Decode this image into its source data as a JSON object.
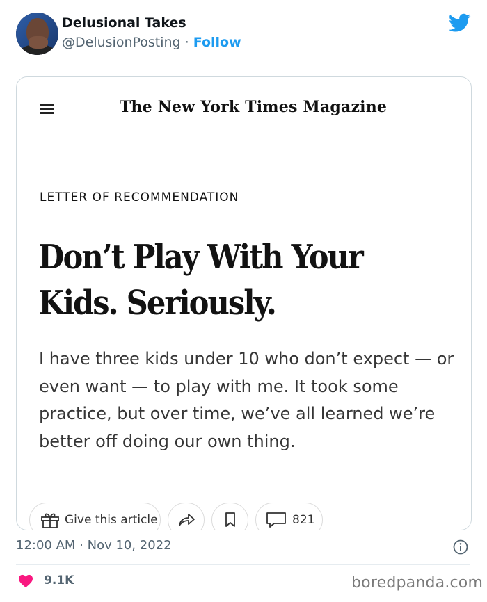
{
  "author": {
    "name": "Delusional Takes",
    "handle": "@DelusionPosting",
    "separator": " · ",
    "follow_label": "Follow"
  },
  "article_card": {
    "masthead": "The New York Times Magazine",
    "kicker": "LETTER OF RECOMMENDATION",
    "headline": "Don’t Play With Your Kids. Seriously.",
    "dek": "I have three kids under 10 who don’t expect — or even want — to play with me. It took some practice, but over time, we’ve all learned we’re better off doing our own thing.",
    "actions": {
      "gift_label": "Give this article",
      "comment_count": "821"
    }
  },
  "footer": {
    "timestamp": "12:00 AM · Nov 10, 2022",
    "like_count": "9.1K",
    "watermark": "boredpanda.com"
  },
  "colors": {
    "accent": "#1d9bf0",
    "heart": "#f91880",
    "muted": "#536471"
  },
  "icons": [
    "twitter-bird-icon",
    "menu-icon",
    "gift-icon",
    "share-icon",
    "bookmark-icon",
    "comment-icon",
    "info-icon",
    "heart-icon"
  ]
}
